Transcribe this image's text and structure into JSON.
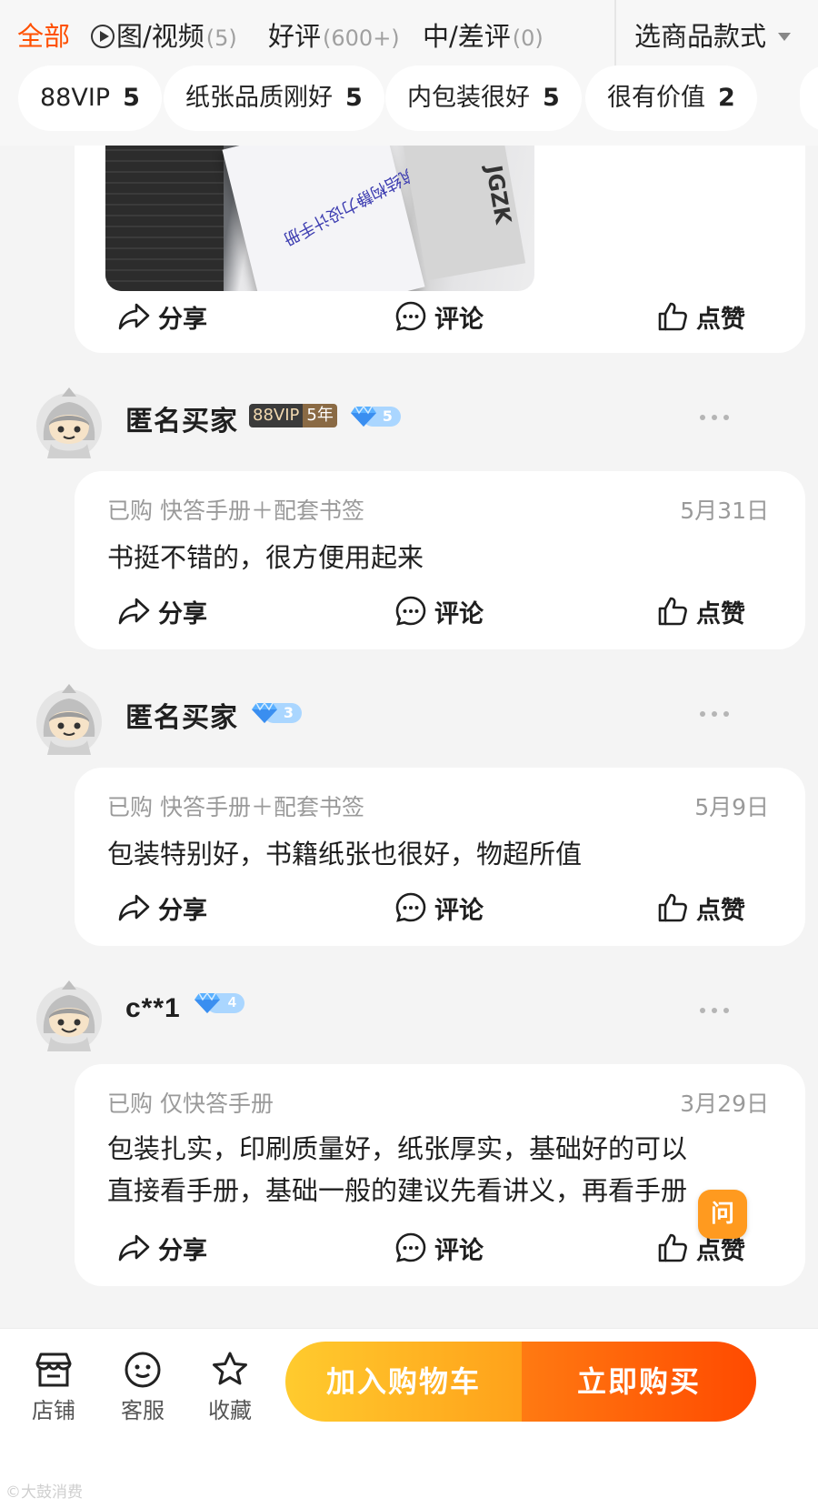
{
  "filter_tabs": {
    "all": {
      "label": "全部"
    },
    "media": {
      "label": "图/视频",
      "count": "(5)"
    },
    "good": {
      "label": "好评",
      "count": "(600+)"
    },
    "bad": {
      "label": "中/差评",
      "count": "(0)"
    },
    "style_select": "选商品款式"
  },
  "tag_chips": [
    {
      "label": "88VIP",
      "count": "5"
    },
    {
      "label": "纸张品质刚好",
      "count": "5"
    },
    {
      "label": "内包装很好",
      "count": "5"
    },
    {
      "label": "很有价值",
      "count": "2"
    }
  ],
  "actions": {
    "share": "分享",
    "comment": "评论",
    "like": "点赞"
  },
  "reviews": [
    {
      "user": "匿名买家",
      "vip": {
        "name": "88VIP",
        "years": "5年"
      },
      "level": "5",
      "purchased": "已购 快答手册＋配套书签",
      "date": "5月31日",
      "text": "书挺不错的，很方便用起来"
    },
    {
      "user": "匿名买家",
      "level": "3",
      "purchased": "已购 快答手册＋配套书签",
      "date": "5月9日",
      "text": "包装特别好，书籍纸张也很好，物超所值"
    },
    {
      "user": "c**1",
      "level": "4",
      "purchased": "已购 仅快答手册",
      "date": "3月29日",
      "text_line1": "包装扎实，印刷质量好，纸张厚实，基础好的可以",
      "text_line2": "直接看手册，基础一般的建议先看讲义，再看手册"
    }
  ],
  "photo_texts": {
    "book": "建筑结构静力设计手册",
    "brand": "JGZK"
  },
  "ask_button": "问",
  "bottom_bar": {
    "shop": "店铺",
    "service": "客服",
    "favorite": "收藏",
    "add_to_cart": "加入购物车",
    "buy_now": "立即购买"
  },
  "watermark": "©大鼓消费"
}
